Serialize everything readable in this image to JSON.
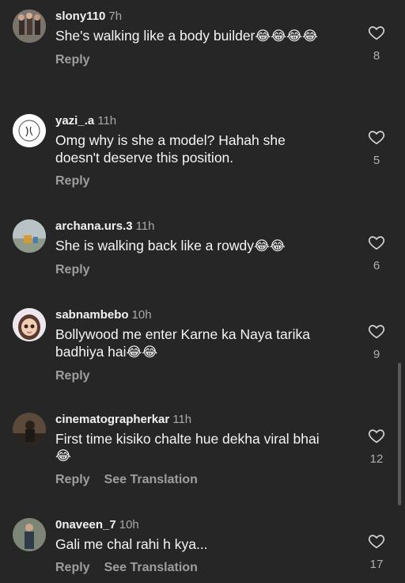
{
  "comments": [
    {
      "username": "slony110",
      "time": "7h",
      "text": "She's walking like a body builder",
      "emoji": "😂😂😂😂",
      "likes": "8",
      "reply": "Reply",
      "translate": ""
    },
    {
      "username": "yazi_.a",
      "time": "11h",
      "text": "Omg why is she a model? Hahah she doesn't deserve this position.",
      "emoji": "",
      "likes": "5",
      "reply": "Reply",
      "translate": ""
    },
    {
      "username": "archana.urs.3",
      "time": "11h",
      "text": "She is walking back like a rowdy",
      "emoji": "😂😂",
      "likes": "6",
      "reply": "Reply",
      "translate": ""
    },
    {
      "username": "sabnambebo",
      "time": "10h",
      "text": "Bollywood me enter Karne ka Naya tarika badhiya hai",
      "emoji": "😂😂",
      "likes": "9",
      "reply": "Reply",
      "translate": ""
    },
    {
      "username": "cinematographerkar",
      "time": "11h",
      "text": "First time kisiko chalte hue dekha viral bhai",
      "emoji": "😂",
      "likes": "12",
      "reply": "Reply",
      "translate": "See Translation"
    },
    {
      "username": "0naveen_7",
      "time": "10h",
      "text": "Gali me chal rahi h kya...",
      "emoji": "",
      "likes": "17",
      "reply": "Reply",
      "translate": "See Translation"
    }
  ],
  "colors": {
    "background": "#262626",
    "text": "#f5f5f5",
    "muted": "#9e9e9e"
  },
  "icons": {
    "like": "heart-outline-icon"
  }
}
